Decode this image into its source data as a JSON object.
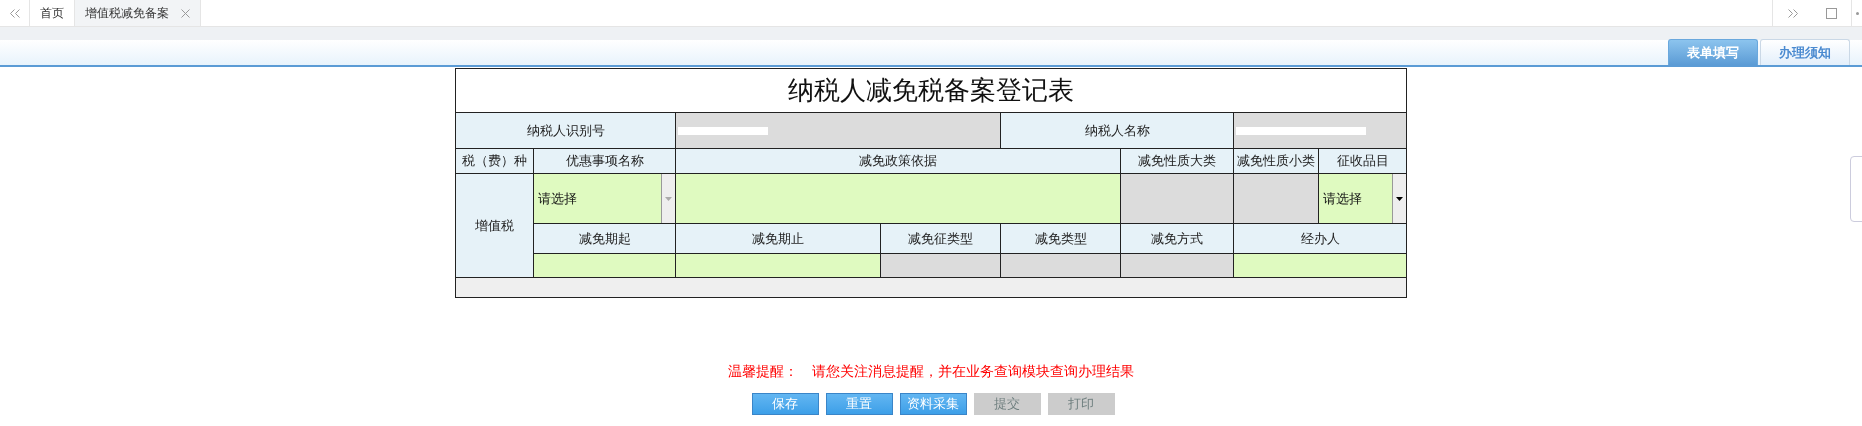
{
  "top_tabs": [
    {
      "label": "首页",
      "selected": false,
      "closable": false
    },
    {
      "label": "增值税减免备案",
      "selected": true,
      "closable": true
    }
  ],
  "form_tabs": [
    {
      "label": "表单填写",
      "selected": true
    },
    {
      "label": "办理须知",
      "selected": false
    }
  ],
  "form": {
    "title": "纳税人减免税备案登记表",
    "taxpayer_id_label": "纳税人识别号",
    "taxpayer_name_label": "纳税人名称",
    "headers": [
      "税（费）种",
      "优惠事项名称",
      "减免政策依据",
      "减免性质大类",
      "减免性质小类",
      "征收品目"
    ],
    "tax_type": "增值税",
    "item_select": {
      "value": "请选择",
      "disabled": true
    },
    "category_select": {
      "value": "请选择",
      "disabled": false
    },
    "sub_headers": [
      "减免期起",
      "减免期止",
      "减免征类型",
      "减免类型",
      "减免方式",
      "经办人"
    ]
  },
  "reminder": {
    "label": "温馨提醒：",
    "text": "请您关注消息提醒，并在业务查询模块查询办理结果"
  },
  "buttons": [
    {
      "label": "保存",
      "disabled": false
    },
    {
      "label": "重置",
      "disabled": false
    },
    {
      "label": "资料采集",
      "disabled": false
    },
    {
      "label": "提交",
      "disabled": true
    },
    {
      "label": "打印",
      "disabled": true
    }
  ]
}
